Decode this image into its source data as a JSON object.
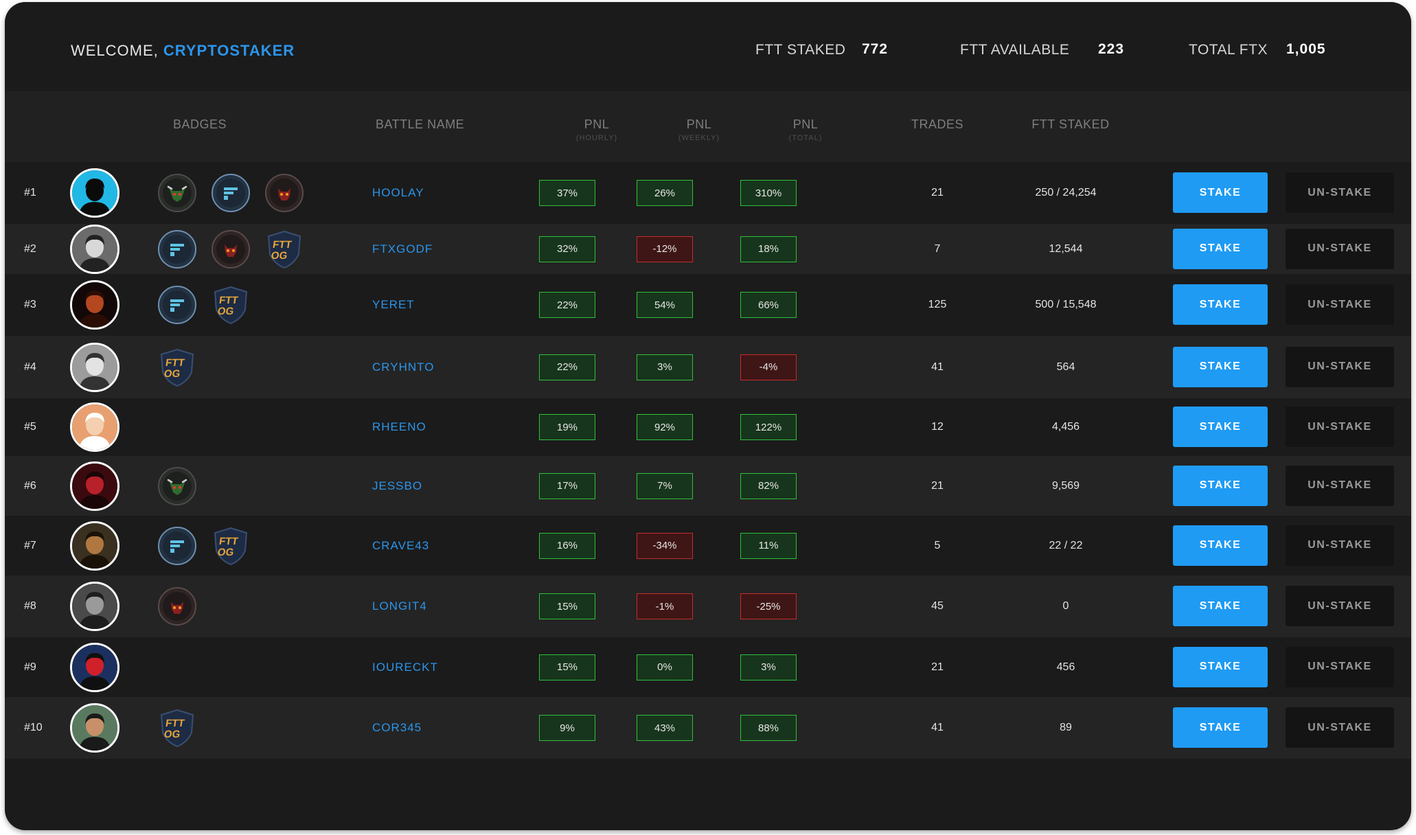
{
  "header": {
    "welcome_label": "WELCOME,",
    "username": "CRYPTOSTAKER",
    "stats": [
      {
        "label": "FTT STAKED",
        "value": "772"
      },
      {
        "label": "FTT AVAILABLE",
        "value": "223"
      },
      {
        "label": "TOTAL FTX",
        "value": "1,005"
      }
    ]
  },
  "columns": {
    "badges": "BADGES",
    "battle_name": "BATTLE NAME",
    "pnl_hourly": {
      "label": "PNL",
      "sub": "(HOURLY)"
    },
    "pnl_weekly": {
      "label": "PNL",
      "sub": "(WEEKLY)"
    },
    "pnl_total": {
      "label": "PNL",
      "sub": "(TOTAL)"
    },
    "trades": "TRADES",
    "ftt_staked": "FTT STAKED"
  },
  "buttons": {
    "stake": "STAKE",
    "unstake": "UN-STAKE"
  },
  "colors": {
    "accent": "#2b95ec",
    "stake_button": "#1f9bf4",
    "positive": "#2fbf3c",
    "negative": "#c52b2b"
  },
  "rows": [
    {
      "rank": "#1",
      "name": "HOOLAY",
      "badges": [
        "bull-badge-icon",
        "ftx-badge-icon",
        "devil-badge-icon"
      ],
      "pnl_hourly": "37%",
      "pnl_weekly": "26%",
      "pnl_total": "310%",
      "trades": "21",
      "ftt_staked": "250 / 24,254"
    },
    {
      "rank": "#2",
      "name": "FTXGODF",
      "badges": [
        "ftx-badge-icon",
        "devil-badge-icon",
        "ftt-og-badge-icon"
      ],
      "pnl_hourly": "32%",
      "pnl_weekly": "-12%",
      "pnl_total": "18%",
      "trades": "7",
      "ftt_staked": "12,544"
    },
    {
      "rank": "#3",
      "name": "YERET",
      "badges": [
        "ftx-badge-icon",
        "ftt-og-badge-icon"
      ],
      "pnl_hourly": "22%",
      "pnl_weekly": "54%",
      "pnl_total": "66%",
      "trades": "125",
      "ftt_staked": "500 / 15,548"
    },
    {
      "rank": "#4",
      "name": "CRYHNTO",
      "badges": [
        "ftt-og-badge-icon"
      ],
      "pnl_hourly": "22%",
      "pnl_weekly": "3%",
      "pnl_total": "-4%",
      "trades": "41",
      "ftt_staked": "564"
    },
    {
      "rank": "#5",
      "name": "RHEENO",
      "badges": [],
      "pnl_hourly": "19%",
      "pnl_weekly": "92%",
      "pnl_total": "122%",
      "trades": "12",
      "ftt_staked": "4,456"
    },
    {
      "rank": "#6",
      "name": "JESSBO",
      "badges": [
        "bull-badge-icon"
      ],
      "pnl_hourly": "17%",
      "pnl_weekly": "7%",
      "pnl_total": "82%",
      "trades": "21",
      "ftt_staked": "9,569"
    },
    {
      "rank": "#7",
      "name": "CRAVE43",
      "badges": [
        "ftx-badge-icon",
        "ftt-og-badge-icon"
      ],
      "pnl_hourly": "16%",
      "pnl_weekly": "-34%",
      "pnl_total": "11%",
      "trades": "5",
      "ftt_staked": "22 / 22"
    },
    {
      "rank": "#8",
      "name": "LONGIT4",
      "badges": [
        "devil-badge-icon"
      ],
      "pnl_hourly": "15%",
      "pnl_weekly": "-1%",
      "pnl_total": "-25%",
      "trades": "45",
      "ftt_staked": "0"
    },
    {
      "rank": "#9",
      "name": "IOURECKT",
      "badges": [],
      "pnl_hourly": "15%",
      "pnl_weekly": "0%",
      "pnl_total": "3%",
      "trades": "21",
      "ftt_staked": "456"
    },
    {
      "rank": "#10",
      "name": "COR345",
      "badges": [
        "ftt-og-badge-icon"
      ],
      "pnl_hourly": "9%",
      "pnl_weekly": "43%",
      "pnl_total": "88%",
      "trades": "41",
      "ftt_staked": "89"
    }
  ]
}
